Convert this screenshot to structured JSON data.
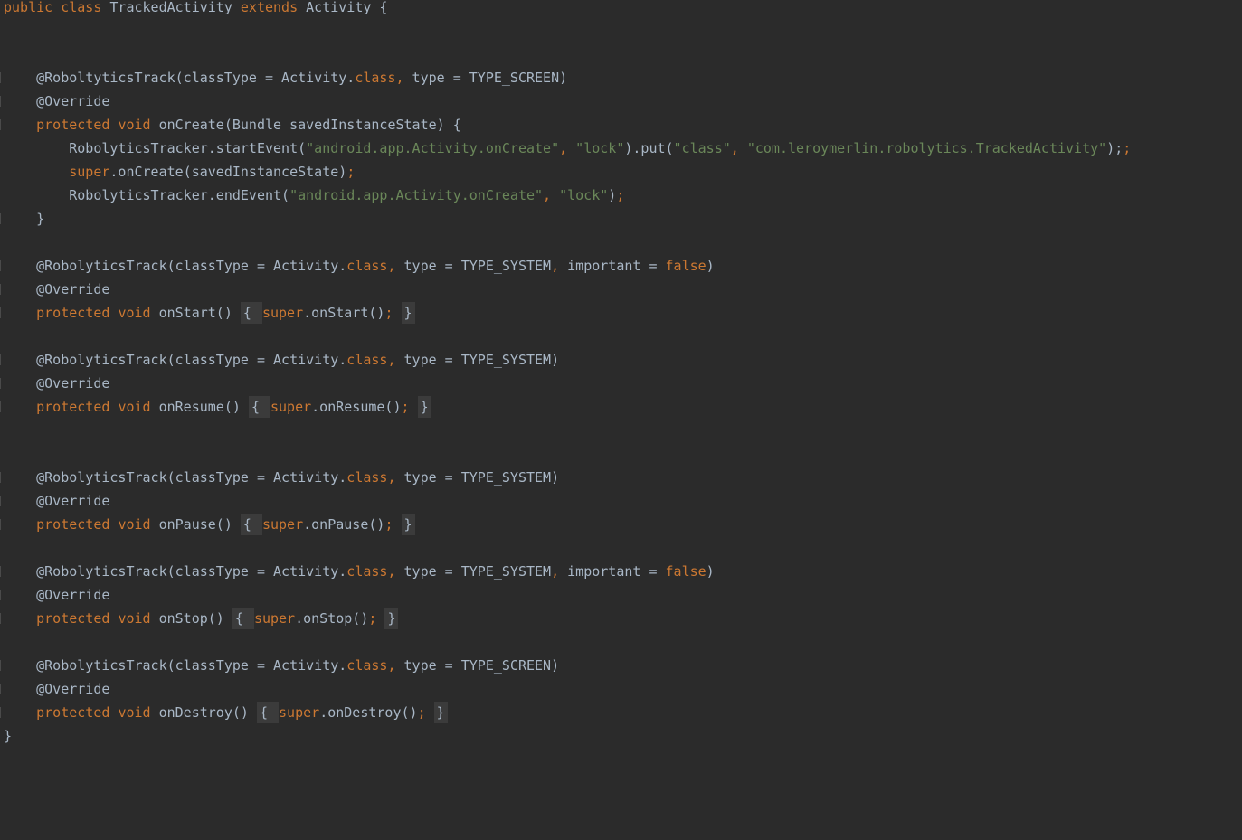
{
  "code_lines": [
    [
      {
        "t": "public",
        "c": "kw"
      },
      {
        "t": " "
      },
      {
        "t": "class",
        "c": "kw"
      },
      {
        "t": " TrackedActivity "
      },
      {
        "t": "extends",
        "c": "kw"
      },
      {
        "t": " Activity {"
      }
    ],
    [],
    [],
    [
      {
        "t": "    @RoboltyticsTrack(classType = Activity."
      },
      {
        "t": "class",
        "c": "kw"
      },
      {
        "t": ", ",
        "c": "kw"
      },
      {
        "t": "type = TYPE_SCREEN)"
      }
    ],
    [
      {
        "t": "    @Override"
      }
    ],
    [
      {
        "t": "    "
      },
      {
        "t": "protected",
        "c": "kw"
      },
      {
        "t": " "
      },
      {
        "t": "void",
        "c": "kw"
      },
      {
        "t": " onCreate(Bundle savedInstanceState) {"
      }
    ],
    [
      {
        "t": "        RobolyticsTracker.startEvent("
      },
      {
        "t": "\"android.app.Activity.onCreate\"",
        "c": "str"
      },
      {
        "t": ", ",
        "c": "kw"
      },
      {
        "t": "\"lock\"",
        "c": "str"
      },
      {
        "t": ").put("
      },
      {
        "t": "\"class\"",
        "c": "str"
      },
      {
        "t": ", ",
        "c": "kw"
      },
      {
        "t": "\"com.leroymerlin.robolytics.TrackedActivity\"",
        "c": "str"
      },
      {
        "t": ");"
      },
      {
        "t": ";",
        "c": "kw"
      }
    ],
    [
      {
        "t": "        "
      },
      {
        "t": "super",
        "c": "kw"
      },
      {
        "t": ".onCreate(savedInstanceState)"
      },
      {
        "t": ";",
        "c": "kw"
      }
    ],
    [
      {
        "t": "        RobolyticsTracker.endEvent("
      },
      {
        "t": "\"android.app.Activity.onCreate\"",
        "c": "str"
      },
      {
        "t": ", ",
        "c": "kw"
      },
      {
        "t": "\"lock\"",
        "c": "str"
      },
      {
        "t": ")"
      },
      {
        "t": ";",
        "c": "kw"
      }
    ],
    [
      {
        "t": "    }"
      }
    ],
    [],
    [
      {
        "t": "    @RobolyticsTrack(classType = Activity."
      },
      {
        "t": "class",
        "c": "kw"
      },
      {
        "t": ", ",
        "c": "kw"
      },
      {
        "t": "type = TYPE_SYSTEM"
      },
      {
        "t": ", ",
        "c": "kw"
      },
      {
        "t": "important = "
      },
      {
        "t": "false",
        "c": "kw"
      },
      {
        "t": ")"
      }
    ],
    [
      {
        "t": "    @Override"
      }
    ],
    [
      {
        "t": "    "
      },
      {
        "t": "protected",
        "c": "kw"
      },
      {
        "t": " "
      },
      {
        "t": "void",
        "c": "kw"
      },
      {
        "t": " onStart() "
      },
      {
        "t": "{ ",
        "c": "fold"
      },
      {
        "t": "super",
        "c": "kw"
      },
      {
        "t": ".onStart()"
      },
      {
        "t": ";",
        "c": "kw"
      },
      {
        "t": " "
      },
      {
        "t": "}",
        "c": "fold"
      }
    ],
    [],
    [
      {
        "t": "    @RobolyticsTrack(classType = Activity."
      },
      {
        "t": "class",
        "c": "kw"
      },
      {
        "t": ", ",
        "c": "kw"
      },
      {
        "t": "type = TYPE_SYSTEM)"
      }
    ],
    [
      {
        "t": "    @Override"
      }
    ],
    [
      {
        "t": "    "
      },
      {
        "t": "protected",
        "c": "kw"
      },
      {
        "t": " "
      },
      {
        "t": "void",
        "c": "kw"
      },
      {
        "t": " onResume() "
      },
      {
        "t": "{ ",
        "c": "fold"
      },
      {
        "t": "super",
        "c": "kw"
      },
      {
        "t": ".onResume()"
      },
      {
        "t": ";",
        "c": "kw"
      },
      {
        "t": " "
      },
      {
        "t": "}",
        "c": "fold"
      }
    ],
    [],
    [],
    [
      {
        "t": "    @RobolyticsTrack(classType = Activity."
      },
      {
        "t": "class",
        "c": "kw"
      },
      {
        "t": ", ",
        "c": "kw"
      },
      {
        "t": "type = TYPE_SYSTEM)"
      }
    ],
    [
      {
        "t": "    @Override"
      }
    ],
    [
      {
        "t": "    "
      },
      {
        "t": "protected",
        "c": "kw"
      },
      {
        "t": " "
      },
      {
        "t": "void",
        "c": "kw"
      },
      {
        "t": " onPause() "
      },
      {
        "t": "{ ",
        "c": "fold"
      },
      {
        "t": "super",
        "c": "kw"
      },
      {
        "t": ".onPause()"
      },
      {
        "t": ";",
        "c": "kw"
      },
      {
        "t": " "
      },
      {
        "t": "}",
        "c": "fold"
      }
    ],
    [],
    [
      {
        "t": "    @RobolyticsTrack(classType = Activity."
      },
      {
        "t": "class",
        "c": "kw"
      },
      {
        "t": ", ",
        "c": "kw"
      },
      {
        "t": "type = TYPE_SYSTEM"
      },
      {
        "t": ", ",
        "c": "kw"
      },
      {
        "t": "important = "
      },
      {
        "t": "false",
        "c": "kw"
      },
      {
        "t": ")"
      }
    ],
    [
      {
        "t": "    @Override"
      }
    ],
    [
      {
        "t": "    "
      },
      {
        "t": "protected",
        "c": "kw"
      },
      {
        "t": " "
      },
      {
        "t": "void",
        "c": "kw"
      },
      {
        "t": " onStop() "
      },
      {
        "t": "{ ",
        "c": "fold"
      },
      {
        "t": "super",
        "c": "kw"
      },
      {
        "t": ".onStop()"
      },
      {
        "t": ";",
        "c": "kw"
      },
      {
        "t": " "
      },
      {
        "t": "}",
        "c": "fold"
      }
    ],
    [],
    [
      {
        "t": "    @RobolyticsTrack(classType = Activity."
      },
      {
        "t": "class",
        "c": "kw"
      },
      {
        "t": ", ",
        "c": "kw"
      },
      {
        "t": "type = TYPE_SCREEN)"
      }
    ],
    [
      {
        "t": "    @Override"
      }
    ],
    [
      {
        "t": "    "
      },
      {
        "t": "protected",
        "c": "kw"
      },
      {
        "t": " "
      },
      {
        "t": "void",
        "c": "kw"
      },
      {
        "t": " onDestroy() "
      },
      {
        "t": "{ ",
        "c": "fold"
      },
      {
        "t": "super",
        "c": "kw"
      },
      {
        "t": ".onDestroy()"
      },
      {
        "t": ";",
        "c": "kw"
      },
      {
        "t": " "
      },
      {
        "t": "}",
        "c": "fold"
      }
    ],
    [
      {
        "t": "}"
      }
    ]
  ],
  "folded_lines": [
    3,
    4,
    5,
    9,
    11,
    12,
    13,
    15,
    16,
    17,
    20,
    21,
    22,
    24,
    25,
    26,
    28,
    29,
    30
  ],
  "colors": {
    "background": "#2b2b2b",
    "default_text": "#a9b7c6",
    "keyword": "#cc7832",
    "string": "#6a8759",
    "fold_background": "#3b3b3b",
    "right_margin": "#3c3c3c"
  }
}
